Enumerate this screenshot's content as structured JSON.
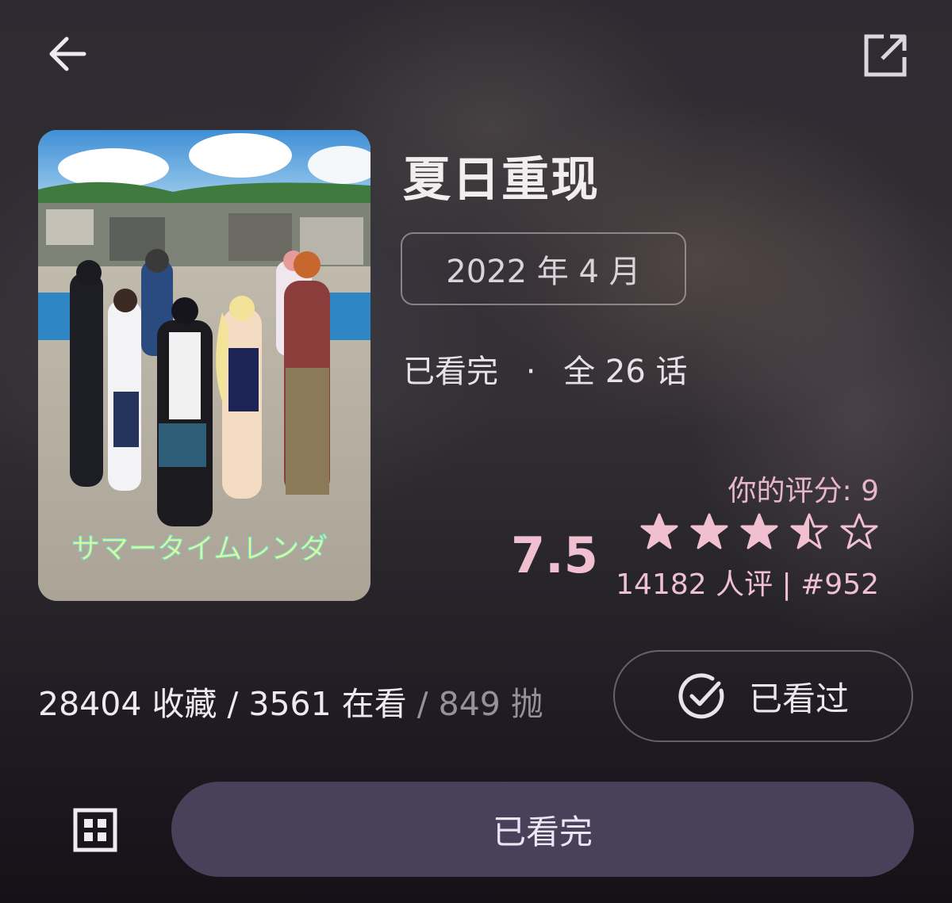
{
  "header": {
    "back_icon": "arrow-left-icon",
    "open_external_icon": "open-in-new-icon"
  },
  "anime": {
    "title": "夏日重现",
    "air_date": "2022 年 4 月",
    "watch_status": "已看完",
    "separator": "·",
    "episodes": "全 26 话",
    "poster_logo_text": "サマータイムレンダ"
  },
  "rating": {
    "your_rating": "你的评分: 9",
    "score": "7.5",
    "stars_value": 3.5,
    "stars_max": 5,
    "votes_rank": "14182 人评 | #952"
  },
  "stats": {
    "collected": "28404 收藏",
    "sep1": " / ",
    "watching": "3561 在看",
    "sep2": " / ",
    "dropped": "849 抛"
  },
  "actions": {
    "watched_label": "已看过",
    "watched_icon": "check-circle-icon",
    "grid_icon": "grid-icon",
    "primary_label": "已看完"
  },
  "colors": {
    "accent_pink": "#f0bfd0",
    "primary_button": "#47415a"
  }
}
